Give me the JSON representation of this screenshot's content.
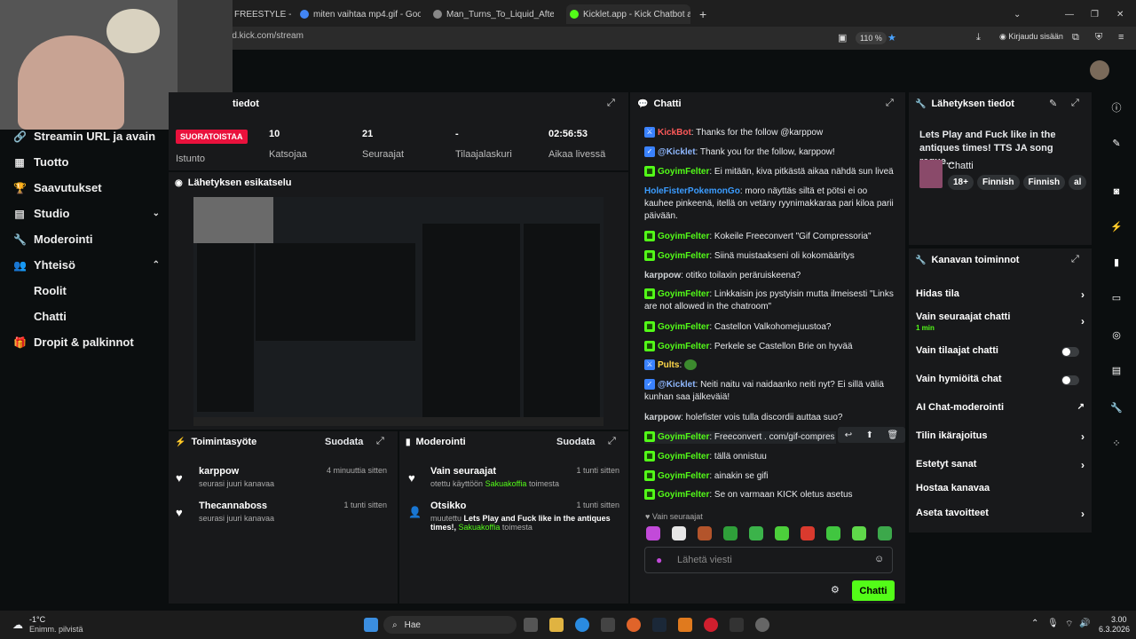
{
  "browser": {
    "tabs": [
      {
        "label": "FREESTYLE -"
      },
      {
        "label": "miten vaihtaa mp4.gif - Google"
      },
      {
        "label": "Man_Turns_To_Liquid_After_Trip"
      },
      {
        "label": "Kicklet.app - Kick Chatbot and"
      }
    ],
    "url": "rd.kick.com/stream",
    "zoom": "110 %",
    "signin": "Kirjaudu sisään"
  },
  "sidebar": {
    "items": [
      {
        "label": "Streamin URL ja avain",
        "icon": "link-icon"
      },
      {
        "label": "Tuotto",
        "icon": "money-icon"
      },
      {
        "label": "Saavutukset",
        "icon": "trophy-icon"
      },
      {
        "label": "Studio",
        "icon": "studio-icon"
      },
      {
        "label": "Moderointi",
        "icon": "wrench-icon"
      },
      {
        "label": "Yhteisö",
        "icon": "community-icon"
      },
      {
        "label": "Roolit"
      },
      {
        "label": "Chatti"
      },
      {
        "label": "Dropit & palkinnot",
        "icon": "gift-icon"
      }
    ]
  },
  "stream_info": {
    "title": "tiedot",
    "status_badge": "SUORATOISTAA",
    "session_label": "Istunto",
    "stats": [
      {
        "value": "10",
        "label": "Katsojaa"
      },
      {
        "value": "21",
        "label": "Seuraajat"
      },
      {
        "value": "-",
        "label": "Tilaajalaskuri"
      },
      {
        "value": "02:56:53",
        "label": "Aikaa livessä"
      }
    ]
  },
  "preview": {
    "title": "Lähetyksen esikatselu"
  },
  "activity": {
    "title": "Toimintasyöte",
    "filter": "Suodata",
    "items": [
      {
        "name": "karppow",
        "sub": "seurasi juuri kanavaa",
        "time": "4 minuuttia sitten"
      },
      {
        "name": "Thecannaboss",
        "sub": "seurasi juuri kanavaa",
        "time": "1 tunti sitten"
      }
    ]
  },
  "moderation": {
    "title": "Moderointi",
    "filter": "Suodata",
    "items": [
      {
        "name": "Vain seuraajat",
        "pre": "otettu käyttöön",
        "actor": "Sakuakoffia",
        "post": "toimesta",
        "time": "1 tunti sitten"
      },
      {
        "name": "Otsikko",
        "pre": "muutettu",
        "title_text": "Lets Play and Fuck like in the antiques times!,",
        "actor": "Sakuakoffia",
        "post": "toimesta",
        "time": "1 tunti sitten"
      }
    ]
  },
  "chat": {
    "title": "Chatti",
    "messages": [
      {
        "user": "KickBot",
        "color": "#ff5a5a",
        "text": ": Thanks for the follow @karppow"
      },
      {
        "user": "@Kicklet",
        "color": "#8fb8ff",
        "text": ": Thank you for the follow, karppow!"
      },
      {
        "user": "GoyimFelter",
        "color": "#53fc18",
        "text": ": Ei mitään, kiva pitkästä aikaa nähdä sun liveä"
      },
      {
        "user": "HoleFisterPokemonGo",
        "color": "#3b9cff",
        "text": ": moro näyttäs siltä et pötsi ei oo kauhee pinkeenä, itellä on vetäny ryynimakkaraa pari kiloa parii päivään."
      },
      {
        "user": "GoyimFelter",
        "color": "#53fc18",
        "text": ": Kokeile Freeconvert \"Gif Compressoria\""
      },
      {
        "user": "GoyimFelter",
        "color": "#53fc18",
        "text": ": Siinä muistaakseni oli kokomääritys"
      },
      {
        "user": "karppow",
        "color": "#cfd3d6",
        "text": ": otitko toilaxin peräruiskeena?"
      },
      {
        "user": "GoyimFelter",
        "color": "#53fc18",
        "text": ": Linkkaisin jos pystyisin mutta ilmeisesti \"Links are not allowed in the chatroom\""
      },
      {
        "user": "GoyimFelter",
        "color": "#53fc18",
        "text": ": Castellon Valkohomejuustoa?"
      },
      {
        "user": "GoyimFelter",
        "color": "#53fc18",
        "text": ": Perkele se Castellon Brie on hyvää"
      },
      {
        "user": "Pults",
        "color": "#ffd84a",
        "text": ":"
      },
      {
        "user": "@Kicklet",
        "color": "#8fb8ff",
        "text": ": Neiti naitu vai naidaanko neiti nyt? Ei sillä väliä kunhan saa jälkeväiä!"
      },
      {
        "user": "karppow",
        "color": "#cfd3d6",
        "text": ": holefister vois tulla discordii auttaa suo?"
      },
      {
        "user": "GoyimFelter",
        "color": "#53fc18",
        "text": ": Freeconvert . com/gif-compres"
      },
      {
        "user": "GoyimFelter",
        "color": "#53fc18",
        "text": ": tällä onnistuu"
      },
      {
        "user": "GoyimFelter",
        "color": "#53fc18",
        "text": ": ainakin se gifi"
      },
      {
        "user": "GoyimFelter",
        "color": "#53fc18",
        "text": ": Se on varmaan KICK oletus asetus"
      }
    ],
    "followers_only": "Vain seuraajat",
    "placeholder": "Lähetä viesti",
    "send_button": "Chatti"
  },
  "broadcast_info": {
    "title": "Lähetyksen tiedot",
    "stream_title": "Lets Play and Fuck like in the antiques times! TTS JA song reque...",
    "category": "Chatti",
    "tags": [
      "18+",
      "Finnish",
      "Finnish",
      "al"
    ]
  },
  "channel_actions": {
    "title": "Kanavan toiminnot",
    "items": [
      {
        "label": "Hidas tila",
        "kind": "chevron"
      },
      {
        "label": "Vain seuraajat chatti",
        "sub": "1 min",
        "kind": "chevron"
      },
      {
        "label": "Vain tilaajat chatti",
        "kind": "toggle"
      },
      {
        "label": "Vain hymiöitä chat",
        "kind": "toggle"
      },
      {
        "label": "AI Chat-moderointi",
        "kind": "external"
      },
      {
        "label": "Tilin ikärajoitus",
        "kind": "chevron"
      },
      {
        "label": "Estetyt sanat",
        "kind": "chevron"
      },
      {
        "label": "Hostaa kanavaa",
        "kind": "none"
      },
      {
        "label": "Aseta tavoitteet",
        "kind": "chevron"
      }
    ]
  },
  "taskbar": {
    "weather_temp": "-1°C",
    "weather_desc": "Enimm. pilvistä",
    "search": "Hae",
    "time": "3.00",
    "date": "6.3.2026"
  }
}
